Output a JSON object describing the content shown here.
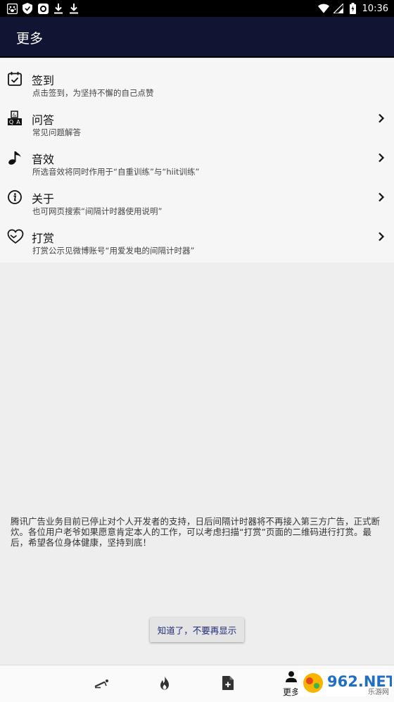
{
  "status_bar": {
    "time": "10:36",
    "icons": [
      "paw-icon",
      "shield-icon",
      "app-icon",
      "download-icon",
      "download-icon",
      "wifi-icon",
      "signal-icon",
      "battery-icon"
    ]
  },
  "app_bar": {
    "title": "更多"
  },
  "menu": {
    "items": [
      {
        "icon": "calendar-check-icon",
        "title": "签到",
        "subtitle": "点击签到，为坚持不懈的自己点赞",
        "has_chevron": false
      },
      {
        "icon": "qa-blocks-icon",
        "title": "问答",
        "subtitle": "常见问题解答",
        "has_chevron": true
      },
      {
        "icon": "music-note-icon",
        "title": "音效",
        "subtitle": "所选音效将同时作用于“自重训练”与“hiit训练”",
        "has_chevron": true
      },
      {
        "icon": "info-icon",
        "title": "关于",
        "subtitle": "也可网页搜索“间隔计时器使用说明”",
        "has_chevron": true
      },
      {
        "icon": "heart-hand-icon",
        "title": "打赏",
        "subtitle": "打赏公示见微博账号“用爱发电的间隔计时器”",
        "has_chevron": true
      }
    ]
  },
  "notice": {
    "text": "腾讯广告业务目前已停止对个人开发者的支持，日后间隔计时器将不再接入第三方广告，正式断炊。各位用户老爷如果愿意肯定本人的工作，可以考虑扫描“打赏”页面的二维码进行打赏。最后，希望各位身体健康，坚持到底！",
    "dismiss_label": "知道了，不要再显示"
  },
  "bottom_nav": {
    "items": [
      {
        "icon": "workout-icon",
        "label": ""
      },
      {
        "icon": "fire-icon",
        "label": ""
      },
      {
        "icon": "add-document-icon",
        "label": ""
      },
      {
        "icon": "person-icon",
        "label": "更多",
        "active": true
      }
    ]
  },
  "watermark": {
    "brand": "962.NET",
    "sub": "乐游网"
  }
}
